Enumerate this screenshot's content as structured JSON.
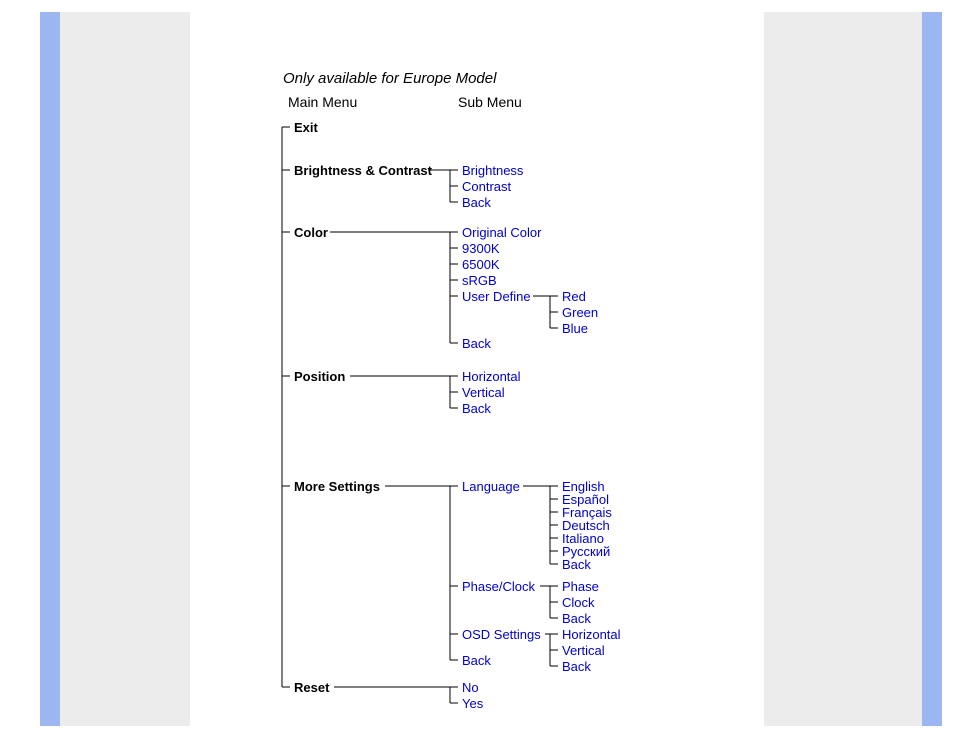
{
  "title": "Only available for Europe Model",
  "headers": {
    "main": "Main Menu",
    "sub": "Sub Menu"
  },
  "main_menu": {
    "exit": "Exit",
    "brightness_contrast": "Brightness & Contrast",
    "color": "Color",
    "position": "Position",
    "more_settings": "More Settings",
    "reset": "Reset"
  },
  "sub_menu": {
    "brightness_contrast": {
      "brightness": "Brightness",
      "contrast": "Contrast",
      "back": "Back"
    },
    "color": {
      "original": "Original Color",
      "k9300": "9300K",
      "k6500": "6500K",
      "srgb": "sRGB",
      "user_define": "User Define",
      "back": "Back",
      "user_define_sub": {
        "red": "Red",
        "green": "Green",
        "blue": "Blue"
      }
    },
    "position": {
      "horizontal": "Horizontal",
      "vertical": "Vertical",
      "back": "Back"
    },
    "more_settings": {
      "language": "Language",
      "language_sub": {
        "english": "English",
        "espanol": "Español",
        "francais": "Français",
        "deutsch": "Deutsch",
        "italiano": "Italiano",
        "russian": "Русский",
        "back": "Back"
      },
      "phase_clock": "Phase/Clock",
      "phase_clock_sub": {
        "phase": "Phase",
        "clock": "Clock",
        "back": "Back"
      },
      "osd": "OSD Settings",
      "osd_sub": {
        "horizontal": "Horizontal",
        "vertical": "Vertical",
        "back": "Back"
      },
      "back": "Back"
    },
    "reset": {
      "no": "No",
      "yes": "Yes"
    }
  }
}
